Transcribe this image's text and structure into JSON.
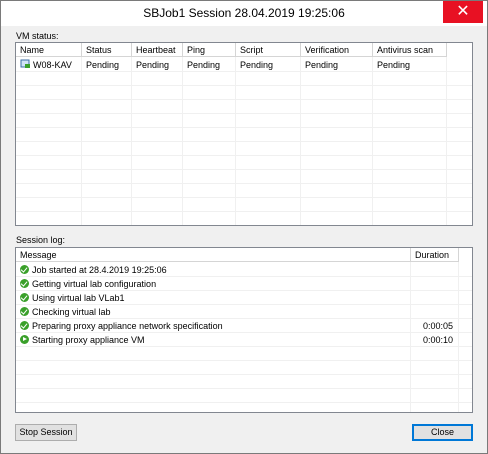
{
  "window": {
    "title": "SBJob1 Session 28.04.2019 19:25:06",
    "close_glyph": "✕"
  },
  "vm_status": {
    "label": "VM status:",
    "columns": [
      "Name",
      "Status",
      "Heartbeat",
      "Ping",
      "Script",
      "Verification",
      "Antivirus scan"
    ],
    "rows": [
      {
        "icon": "vm-icon",
        "cells": [
          "W08-KAV",
          "Pending",
          "Pending",
          "Pending",
          "Pending",
          "Pending",
          "Pending"
        ]
      }
    ]
  },
  "session_log": {
    "label": "Session log:",
    "columns": [
      "Message",
      "Duration"
    ],
    "rows": [
      {
        "icon": "success-icon",
        "message": "Job started at 28.4.2019 19:25:06",
        "duration": ""
      },
      {
        "icon": "success-icon",
        "message": "Getting virtual lab configuration",
        "duration": ""
      },
      {
        "icon": "success-icon",
        "message": "Using virtual lab VLab1",
        "duration": ""
      },
      {
        "icon": "success-icon",
        "message": "Checking virtual lab",
        "duration": ""
      },
      {
        "icon": "success-icon",
        "message": "Preparing proxy appliance network specification",
        "duration": "0:00:05"
      },
      {
        "icon": "running-icon",
        "message": "Starting proxy appliance VM",
        "duration": "0:00:10"
      }
    ]
  },
  "buttons": {
    "stop_session": "Stop Session",
    "close": "Close"
  },
  "colors": {
    "success": "#3aa02a",
    "close_red": "#e81123",
    "default_border": "#0078d7"
  }
}
